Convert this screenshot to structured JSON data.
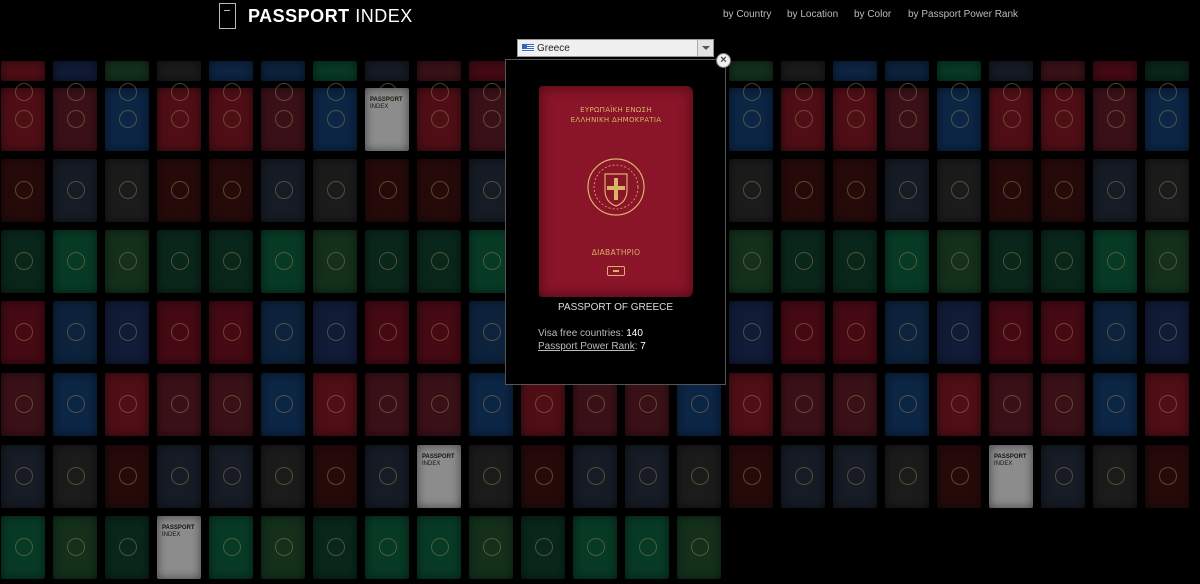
{
  "header": {
    "logo_bold": "PASSPORT",
    "logo_light": " INDEX",
    "nav": [
      {
        "label": "by Country"
      },
      {
        "label": "by Location"
      },
      {
        "label": "by Color"
      },
      {
        "label": "by Passport Power Rank"
      }
    ]
  },
  "country_select": {
    "selected": "Greece",
    "flag_icon": "greece-flag-icon"
  },
  "popup": {
    "cover_line1": "ΕΥΡΩΠΑΪΚΗ ΕΝΩΣΗ",
    "cover_line2": "ΕΛΛΗΝΙΚΗ ΔΗΜΟΚΡΑΤΙΑ",
    "cover_doc": "ΔΙΑΒΑΤΗΡΙΟ",
    "title": "PASSPORT OF GREECE",
    "visa_free_label": "Visa free countries:",
    "visa_free_value": "140",
    "rank_label": "Passport Power Rank",
    "rank_sep": ":",
    "rank_value": "7",
    "close_icon": "close-icon",
    "cover_color": "#8a1428"
  },
  "grid": {
    "placeholder_label_1": "PASSPORT",
    "placeholder_label_2": "INDEX",
    "palette": [
      "#7a1622",
      "#14355e",
      "#0f3b28",
      "#2a2a2a",
      "#5a1a25",
      "#1a2a55",
      "#0c5a3a",
      "#3b1010",
      "#123a6a",
      "#6b0f1f",
      "#1f4a2a",
      "#222a3a"
    ]
  }
}
